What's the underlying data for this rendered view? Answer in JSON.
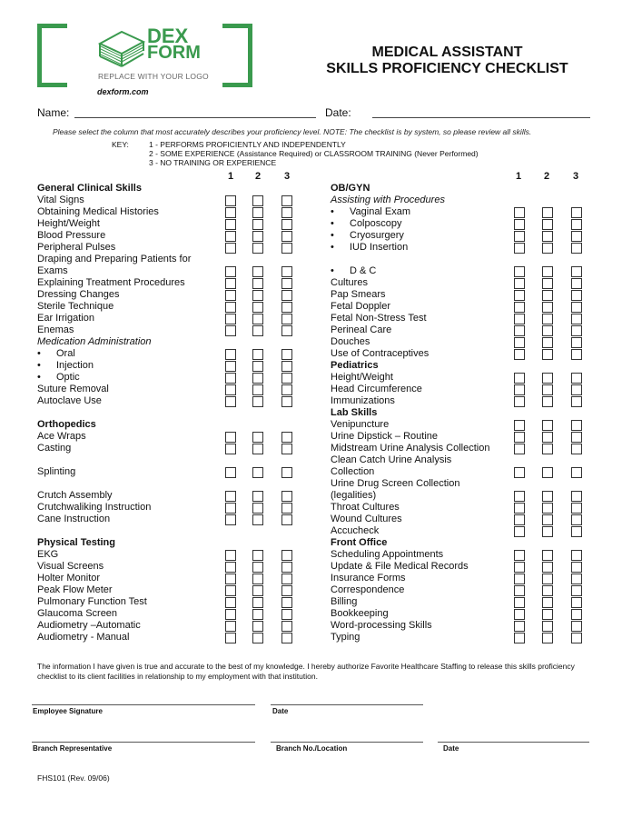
{
  "logo": {
    "brand_line1": "DEX",
    "brand_line2": "FORM",
    "tagline": "REPLACE WITH YOUR LOGO",
    "website": "dexform.com",
    "brand_color": "#3a9a4e",
    "icon": "stacked-papers-icon"
  },
  "header": {
    "title_line1": "MEDICAL ASSISTANT",
    "title_line2": "SKILLS PROFICIENCY CHECKLIST"
  },
  "fields": {
    "name_label": "Name:",
    "name_value": "",
    "date_label": "Date:",
    "date_value": ""
  },
  "instructions": "Please select the column that most accurately describes your proficiency level.  NOTE:  The checklist is by system, so please review all skills.",
  "key": {
    "label": "KEY:",
    "items": [
      "1 - PERFORMS PROFICIENTLY AND INDEPENDENTLY",
      "2 - SOME EXPERIENCE (Assistance Required) or CLASSROOM TRAINING (Never Performed)",
      "3 - NO TRAINING OR EXPERIENCE"
    ]
  },
  "column_headers": [
    "1",
    "2",
    "3"
  ],
  "left_column": [
    {
      "type": "section",
      "label": "General Clinical Skills"
    },
    {
      "type": "item",
      "label": "Vital Signs"
    },
    {
      "type": "item",
      "label": "Obtaining Medical Histories"
    },
    {
      "type": "item",
      "label": "Height/Weight"
    },
    {
      "type": "item",
      "label": "Blood Pressure"
    },
    {
      "type": "item",
      "label": "Peripheral Pulses"
    },
    {
      "type": "text",
      "label": "Draping and Preparing Patients for"
    },
    {
      "type": "item",
      "label": "Exams"
    },
    {
      "type": "item",
      "label": "Explaining Treatment Procedures"
    },
    {
      "type": "item",
      "label": "Dressing Changes"
    },
    {
      "type": "item",
      "label": "Sterile Technique"
    },
    {
      "type": "item",
      "label": "Ear Irrigation"
    },
    {
      "type": "item",
      "label": "Enemas"
    },
    {
      "type": "sub",
      "label": "Medication Administration"
    },
    {
      "type": "bullet",
      "label": "Oral"
    },
    {
      "type": "bullet",
      "label": "Injection"
    },
    {
      "type": "bullet",
      "label": "Optic"
    },
    {
      "type": "item",
      "label": "Suture Removal"
    },
    {
      "type": "item",
      "label": "Autoclave Use"
    },
    {
      "type": "blank",
      "label": ""
    },
    {
      "type": "section",
      "label": "Orthopedics"
    },
    {
      "type": "item",
      "label": "Ace Wraps"
    },
    {
      "type": "item",
      "label": "Casting"
    },
    {
      "type": "blank",
      "label": ""
    },
    {
      "type": "item",
      "label": "Splinting"
    },
    {
      "type": "blank",
      "label": ""
    },
    {
      "type": "item",
      "label": "Crutch Assembly"
    },
    {
      "type": "item",
      "label": "Crutchwaliking Instruction"
    },
    {
      "type": "item",
      "label": "Cane Instruction"
    },
    {
      "type": "blank",
      "label": ""
    },
    {
      "type": "section",
      "label": "Physical Testing"
    },
    {
      "type": "item",
      "label": "EKG"
    },
    {
      "type": "item",
      "label": "Visual Screens"
    },
    {
      "type": "item",
      "label": "Holter Monitor"
    },
    {
      "type": "item",
      "label": "Peak Flow Meter"
    },
    {
      "type": "item",
      "label": "Pulmonary Function Test"
    },
    {
      "type": "item",
      "label": "Glaucoma Screen"
    },
    {
      "type": "item",
      "label": "Audiometry –Automatic"
    },
    {
      "type": "item",
      "label": "Audiometry - Manual"
    }
  ],
  "right_column": [
    {
      "type": "section",
      "label": "OB/GYN"
    },
    {
      "type": "sub",
      "label": "Assisting with Procedures"
    },
    {
      "type": "bullet",
      "label": "Vaginal Exam"
    },
    {
      "type": "bullet",
      "label": "Colposcopy"
    },
    {
      "type": "bullet",
      "label": "Cryosurgery"
    },
    {
      "type": "bullet",
      "label": "IUD Insertion"
    },
    {
      "type": "blank",
      "label": ""
    },
    {
      "type": "bullet",
      "label": "D &  C"
    },
    {
      "type": "item",
      "label": "Cultures"
    },
    {
      "type": "item",
      "label": "Pap Smears"
    },
    {
      "type": "item",
      "label": "Fetal Doppler"
    },
    {
      "type": "item",
      "label": "Fetal Non-Stress Test"
    },
    {
      "type": "item",
      "label": "Perineal Care"
    },
    {
      "type": "item",
      "label": "Douches"
    },
    {
      "type": "item",
      "label": "Use of Contraceptives"
    },
    {
      "type": "section",
      "label": "Pediatrics"
    },
    {
      "type": "item",
      "label": "Height/Weight"
    },
    {
      "type": "item",
      "label": "Head Circumference"
    },
    {
      "type": "item",
      "label": "Immunizations"
    },
    {
      "type": "section",
      "label": "Lab Skills"
    },
    {
      "type": "item",
      "label": "Venipuncture"
    },
    {
      "type": "item",
      "label": "Urine Dipstick – Routine"
    },
    {
      "type": "item",
      "label": "Midstream Urine Analysis Collection"
    },
    {
      "type": "text",
      "label": "Clean Catch Urine Analysis"
    },
    {
      "type": "item",
      "label": "Collection"
    },
    {
      "type": "text",
      "label": "Urine Drug Screen Collection"
    },
    {
      "type": "item",
      "label": "(legalities)"
    },
    {
      "type": "item",
      "label": "Throat Cultures"
    },
    {
      "type": "item",
      "label": "Wound Cultures"
    },
    {
      "type": "item",
      "label": "Accucheck"
    },
    {
      "type": "section",
      "label": "Front Office"
    },
    {
      "type": "item",
      "label": "Scheduling Appointments"
    },
    {
      "type": "item",
      "label": "Update & File Medical Records"
    },
    {
      "type": "item",
      "label": "Insurance Forms"
    },
    {
      "type": "item",
      "label": "Correspondence"
    },
    {
      "type": "item",
      "label": "Billing"
    },
    {
      "type": "item",
      "label": "Bookkeeping"
    },
    {
      "type": "item",
      "label": "Word-processing Skills"
    },
    {
      "type": "item",
      "label": "Typing"
    }
  ],
  "declaration": "The information I have given is true and accurate to the best of my knowledge.  I hereby authorize Favorite Healthcare Staffing to release this skills proficiency checklist to its client facilities in relationship to my employment with that institution.",
  "signatures": {
    "employee_signature": "Employee Signature",
    "employee_date": "Date",
    "branch_representative": "Branch Representative",
    "branch_location": "Branch No./Location",
    "branch_date": "Date"
  },
  "form_number": "FHS101 (Rev. 09/06)"
}
